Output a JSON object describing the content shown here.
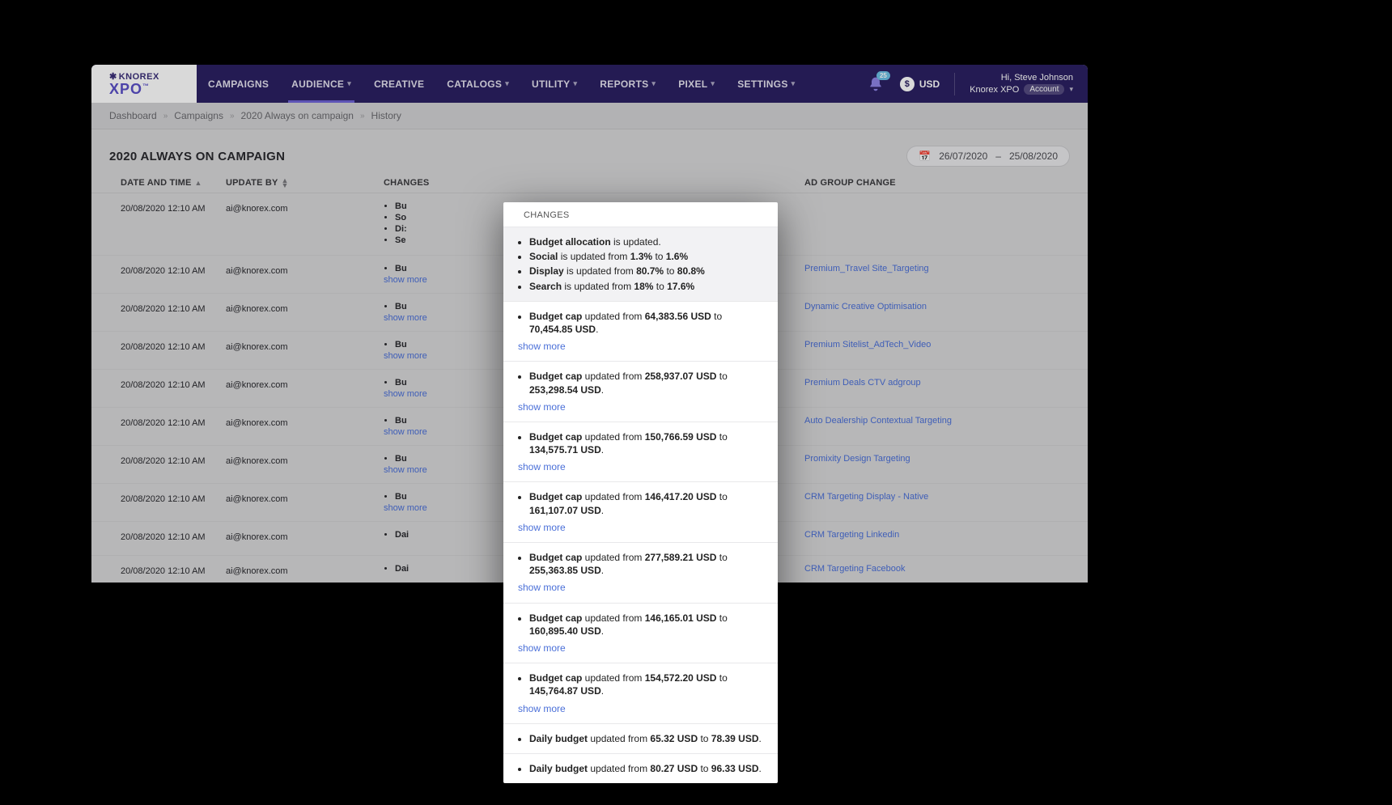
{
  "brand": {
    "top": "KNOREX",
    "bottom": "XPO"
  },
  "nav": {
    "items": [
      {
        "label": "CAMPAIGNS",
        "dd": false
      },
      {
        "label": "AUDIENCE",
        "dd": true,
        "active": true
      },
      {
        "label": "CREATIVE",
        "dd": false
      },
      {
        "label": "CATALOGS",
        "dd": true
      },
      {
        "label": "UTILITY",
        "dd": true
      },
      {
        "label": "REPORTS",
        "dd": true
      },
      {
        "label": "PIXEL",
        "dd": true
      },
      {
        "label": "SETTINGS",
        "dd": true
      }
    ],
    "badge": "25",
    "currency": "USD",
    "greeting": "Hi, Steve Johnson",
    "org": "Knorex XPO",
    "account_pill": "Account"
  },
  "crumbs": [
    "Dashboard",
    "Campaigns",
    "2020 Always on campaign",
    "History"
  ],
  "page_title": "2020 ALWAYS ON CAMPAIGN",
  "date_range": {
    "from": "26/07/2020",
    "to": "25/08/2020",
    "sep": "–"
  },
  "columns": {
    "dt": "DATE AND TIME",
    "ub": "UPDATE BY",
    "ch": "CHANGES",
    "ag": "AD GROUP CHANGE"
  },
  "rows": [
    {
      "dt": "20/08/2020 12:10 AM",
      "ub": "ai@knorex.com",
      "lines": [
        "Bu",
        "So",
        "Di:",
        "Se"
      ],
      "sm": false,
      "ag": ""
    },
    {
      "dt": "20/08/2020 12:10 AM",
      "ub": "ai@knorex.com",
      "lines": [
        "Bu"
      ],
      "sm": true,
      "ag": "Premium_Travel Site_Targeting"
    },
    {
      "dt": "20/08/2020 12:10 AM",
      "ub": "ai@knorex.com",
      "lines": [
        "Bu"
      ],
      "sm": true,
      "ag": "Dynamic Creative Optimisation"
    },
    {
      "dt": "20/08/2020 12:10 AM",
      "ub": "ai@knorex.com",
      "lines": [
        "Bu"
      ],
      "sm": true,
      "ag": "Premium Sitelist_AdTech_Video"
    },
    {
      "dt": "20/08/2020 12:10 AM",
      "ub": "ai@knorex.com",
      "lines": [
        "Bu"
      ],
      "sm": true,
      "ag": "Premium Deals CTV adgroup"
    },
    {
      "dt": "20/08/2020 12:10 AM",
      "ub": "ai@knorex.com",
      "lines": [
        "Bu"
      ],
      "sm": true,
      "ag": "Auto Dealership Contextual Targeting"
    },
    {
      "dt": "20/08/2020 12:10 AM",
      "ub": "ai@knorex.com",
      "lines": [
        "Bu"
      ],
      "sm": true,
      "ag": "Promixity Design Targeting"
    },
    {
      "dt": "20/08/2020 12:10 AM",
      "ub": "ai@knorex.com",
      "lines": [
        "Bu"
      ],
      "sm": true,
      "ag": "CRM Targeting Display - Native"
    },
    {
      "dt": "20/08/2020 12:10 AM",
      "ub": "ai@knorex.com",
      "lines": [
        "Dai"
      ],
      "sm": false,
      "ag": "CRM Targeting Linkedin"
    },
    {
      "dt": "20/08/2020 12:10 AM",
      "ub": "ai@knorex.com",
      "lines": [
        "Dai"
      ],
      "sm": false,
      "ag": "CRM Targeting Facebook"
    }
  ],
  "show_more": "show more",
  "popup": {
    "header": "CHANGES",
    "groups": [
      {
        "items": [
          {
            "html": "<span class='bold'>Budget allocation</span> is updated."
          },
          {
            "html": "<span class='bold'>Social</span> is updated from <span class='bold'>1.3%</span> to <span class='bold'>1.6%</span>"
          },
          {
            "html": "<span class='bold'>Display</span> is updated from <span class='bold'>80.7%</span> to <span class='bold'>80.8%</span>"
          },
          {
            "html": "<span class='bold'>Search</span> is updated from <span class='bold'>18%</span> to <span class='bold'>17.6%</span>"
          }
        ],
        "sm": false,
        "cls": "grp0"
      },
      {
        "items": [
          {
            "html": "<span class='bold'>Budget cap</span> updated from <span class='bold'>64,383.56 USD</span> to <span class='bold'>70,454.85 USD</span>."
          }
        ],
        "sm": true
      },
      {
        "items": [
          {
            "html": "<span class='bold'>Budget cap</span> updated from <span class='bold'>258,937.07 USD</span> to <span class='bold'>253,298.54 USD</span>."
          }
        ],
        "sm": true
      },
      {
        "items": [
          {
            "html": "<span class='bold'>Budget cap</span> updated from <span class='bold'>150,766.59 USD</span> to <span class='bold'>134,575.71 USD</span>."
          }
        ],
        "sm": true
      },
      {
        "items": [
          {
            "html": "<span class='bold'>Budget cap</span> updated from <span class='bold'>146,417.20 USD</span> to <span class='bold'>161,107.07 USD</span>."
          }
        ],
        "sm": true
      },
      {
        "items": [
          {
            "html": "<span class='bold'>Budget cap</span> updated from <span class='bold'>277,589.21 USD</span> to <span class='bold'>255,363.85 USD</span>."
          }
        ],
        "sm": true
      },
      {
        "items": [
          {
            "html": "<span class='bold'>Budget cap</span> updated from <span class='bold'>146,165.01 USD</span> to <span class='bold'>160,895.40 USD</span>."
          }
        ],
        "sm": true
      },
      {
        "items": [
          {
            "html": "<span class='bold'>Budget cap</span> updated from <span class='bold'>154,572.20 USD</span> to <span class='bold'>145,764.87 USD</span>."
          }
        ],
        "sm": true
      },
      {
        "items": [
          {
            "html": "<span class='bold'>Daily budget</span> updated from <span class='bold'>65.32 USD</span> to <span class='bold'>78.39 USD</span>."
          }
        ],
        "sm": false
      },
      {
        "items": [
          {
            "html": "<span class='bold'>Daily budget</span> updated from <span class='bold'>80.27 USD</span> to <span class='bold'>96.33 USD</span>."
          }
        ],
        "sm": false
      }
    ]
  }
}
